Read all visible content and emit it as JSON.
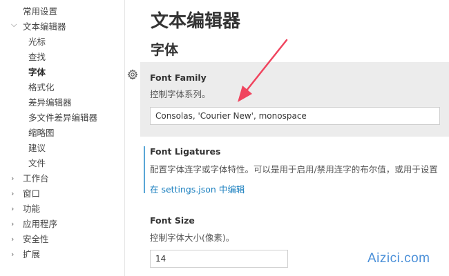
{
  "sidebar": {
    "items": [
      {
        "label": "常用设置",
        "expander": ""
      },
      {
        "label": "文本编辑器",
        "expander": "⌵"
      },
      {
        "label": "光标",
        "expander": ""
      },
      {
        "label": "查找",
        "expander": ""
      },
      {
        "label": "字体",
        "expander": ""
      },
      {
        "label": "格式化",
        "expander": ""
      },
      {
        "label": "差异编辑器",
        "expander": ""
      },
      {
        "label": "多文件差异编辑器",
        "expander": ""
      },
      {
        "label": "缩略图",
        "expander": ""
      },
      {
        "label": "建议",
        "expander": ""
      },
      {
        "label": "文件",
        "expander": ""
      },
      {
        "label": "工作台",
        "expander": "›"
      },
      {
        "label": "窗口",
        "expander": "›"
      },
      {
        "label": "功能",
        "expander": "›"
      },
      {
        "label": "应用程序",
        "expander": "›"
      },
      {
        "label": "安全性",
        "expander": "›"
      },
      {
        "label": "扩展",
        "expander": "›"
      }
    ]
  },
  "main": {
    "page_title": "文本编辑器",
    "section_title": "字体",
    "settings": {
      "font_family": {
        "name": "Font Family",
        "description": "控制字体系列。",
        "value": "Consolas, 'Courier New', monospace"
      },
      "font_ligatures": {
        "name": "Font Ligatures",
        "description": "配置字体连字或字体特性。可以是用于启用/禁用连字的布尔值，或用于设置",
        "link": "在 settings.json 中编辑"
      },
      "font_size": {
        "name": "Font Size",
        "description": "控制字体大小(像素)。",
        "value": "14"
      }
    }
  },
  "watermark": "Aizici.com",
  "colors": {
    "accent_link": "#1a7fbf",
    "modified_bar": "#58a6d6",
    "annotation_arrow": "#f0445e"
  },
  "icons": {
    "setting_gear": "gear-icon",
    "annotation": "arrow-annotation"
  }
}
